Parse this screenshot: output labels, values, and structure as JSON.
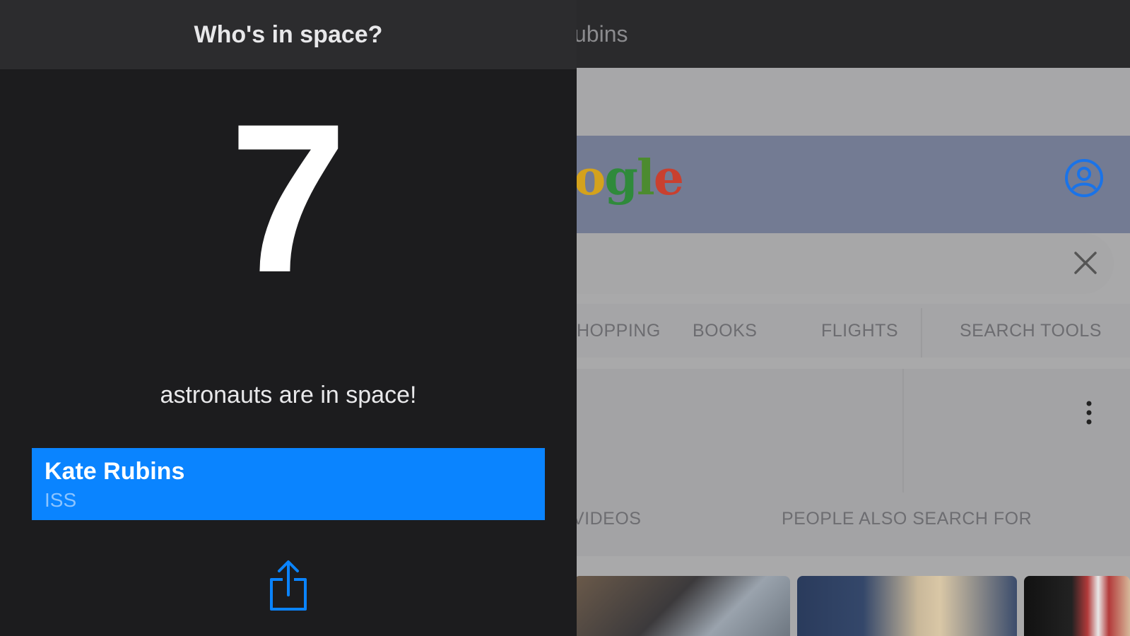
{
  "browser": {
    "title_fragment": "ubins",
    "logo_text": "ogle",
    "tabs": [
      "HOPPING",
      "BOOKS",
      "FLIGHTS",
      "SEARCH TOOLS"
    ],
    "card_labels": [
      "VIDEOS",
      "PEOPLE ALSO SEARCH FOR"
    ]
  },
  "panel": {
    "title": "Who's in space?",
    "count": "7",
    "subtitle": "astronauts are in space!",
    "astronauts": [
      {
        "name": "Kate Rubins",
        "craft": "ISS"
      }
    ],
    "share_icon": "share-icon"
  },
  "colors": {
    "accent": "#0a84ff",
    "panel_bg": "#1c1c1e",
    "header_bg": "#2c2c2e"
  }
}
